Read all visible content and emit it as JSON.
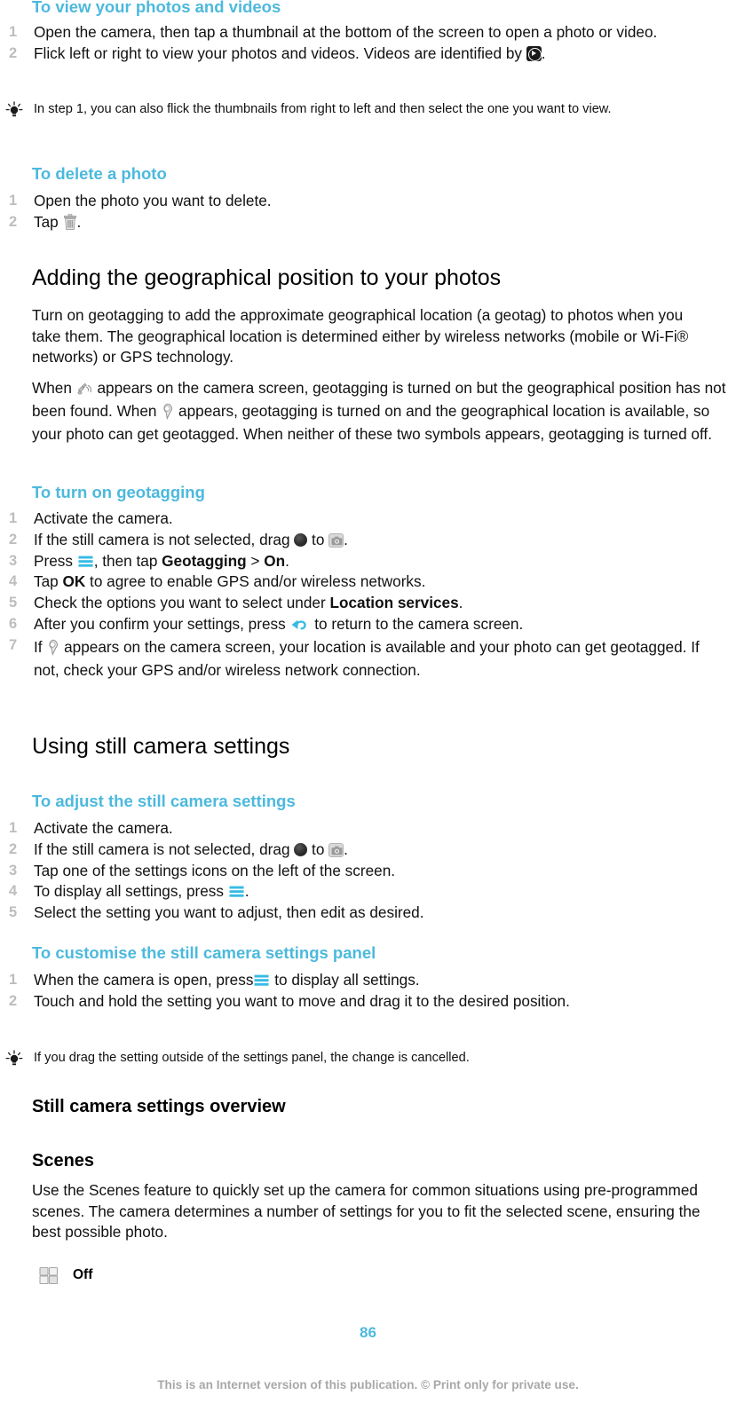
{
  "document": {
    "page_number": "86",
    "footer_note": "This is an Internet version of this publication. © Print only for private use.",
    "accent_color": "#4cb9dd",
    "step_number_color": "#bdbdbd"
  },
  "sections": {
    "view_photos": {
      "heading": "To view your photos and videos",
      "steps": [
        {
          "text_before": "Open the camera, then tap a thumbnail at the bottom of the screen to open a photo or video.",
          "text_after": ""
        },
        {
          "text_before": "Flick left or right to view your photos and videos. Videos are identified by ",
          "icon": "video-play-icon",
          "text_after": "."
        }
      ],
      "tip": "In step 1, you can also flick the thumbnails from right to left and then select the one you want to view."
    },
    "delete_photo": {
      "heading": "To delete a photo",
      "steps": [
        {
          "text_before": "Open the photo you want to delete.",
          "text_after": ""
        },
        {
          "text_before": "Tap ",
          "icon": "trash-icon",
          "text_after": "."
        }
      ]
    },
    "geographical": {
      "heading": "Adding the geographical position to your photos",
      "paragraph1": "Turn on geotagging to add the approximate geographical location (a geotag) to photos when you take them. The geographical location is determined either by wireless networks (mobile or Wi-Fi® networks) or GPS technology.",
      "paragraph2_part1": "When ",
      "paragraph2_icon1": "gps-searching-icon",
      "paragraph2_part2": " appears on the camera screen, geotagging is turned on but the geographical position has not been found. When ",
      "paragraph2_icon2": "map-pin-icon",
      "paragraph2_part3": " appears, geotagging is turned on and the geographical location is available, so your photo can get geotagged. When neither of these two symbols appears, geotagging is turned off."
    },
    "turn_on_geotagging": {
      "heading": "To turn on geotagging",
      "steps": [
        {
          "text": "Activate the camera."
        },
        {
          "p1": "If the still camera is not selected, drag ",
          "icon1": "drag-dot-icon",
          "p2": " to ",
          "icon2": "still-camera-icon",
          "p3": "."
        },
        {
          "p1": "Press ",
          "icon1": "menu-icon",
          "p2": ", then tap ",
          "bold1": "Geotagging",
          "p3": " > ",
          "bold2": "On",
          "p4": "."
        },
        {
          "p1": "Tap ",
          "bold1": "OK",
          "p2": " to agree to enable GPS and/or wireless networks."
        },
        {
          "p1": "Check the options you want to select under ",
          "bold1": "Location services",
          "p2": "."
        },
        {
          "p1": "After you confirm your settings, press ",
          "icon1": "back-arrow-icon",
          "p2": " to return to the camera screen."
        },
        {
          "p1": "If ",
          "icon1": "map-pin-icon",
          "p2": " appears on the camera screen, your location is available and your photo can get geotagged. If not, check your GPS and/or wireless network connection."
        }
      ]
    },
    "using_still_camera": {
      "heading": "Using still camera settings"
    },
    "adjust_settings": {
      "heading": "To adjust the still camera settings",
      "steps": [
        {
          "text": "Activate the camera."
        },
        {
          "p1": "If the still camera is not selected, drag ",
          "icon1": "drag-dot-icon",
          "p2": " to ",
          "icon2": "still-camera-icon",
          "p3": "."
        },
        {
          "text": "Tap one of the settings icons on the left of the screen."
        },
        {
          "p1": "To display all settings, press ",
          "icon1": "menu-icon",
          "p2": "."
        },
        {
          "text": "Select the setting you want to adjust, then edit as desired."
        }
      ]
    },
    "customise_panel": {
      "heading": "To customise the still camera settings panel",
      "steps": [
        {
          "p1": "When the camera is open, press",
          "icon1": "menu-icon",
          "p2": " to display all settings."
        },
        {
          "text": "Touch and hold the setting you want to move and drag it to the desired position."
        }
      ],
      "tip": "If you drag the setting outside of the settings panel, the change is cancelled."
    },
    "settings_overview": {
      "heading": "Still camera settings overview"
    },
    "scenes": {
      "heading": "Scenes",
      "paragraph": "Use the Scenes feature to quickly set up the camera for common situations using pre-programmed scenes. The camera determines a number of settings for you to fit the selected scene, ensuring the best possible photo.",
      "items": [
        {
          "icon": "scenes-off-icon",
          "label": "Off"
        }
      ]
    }
  }
}
